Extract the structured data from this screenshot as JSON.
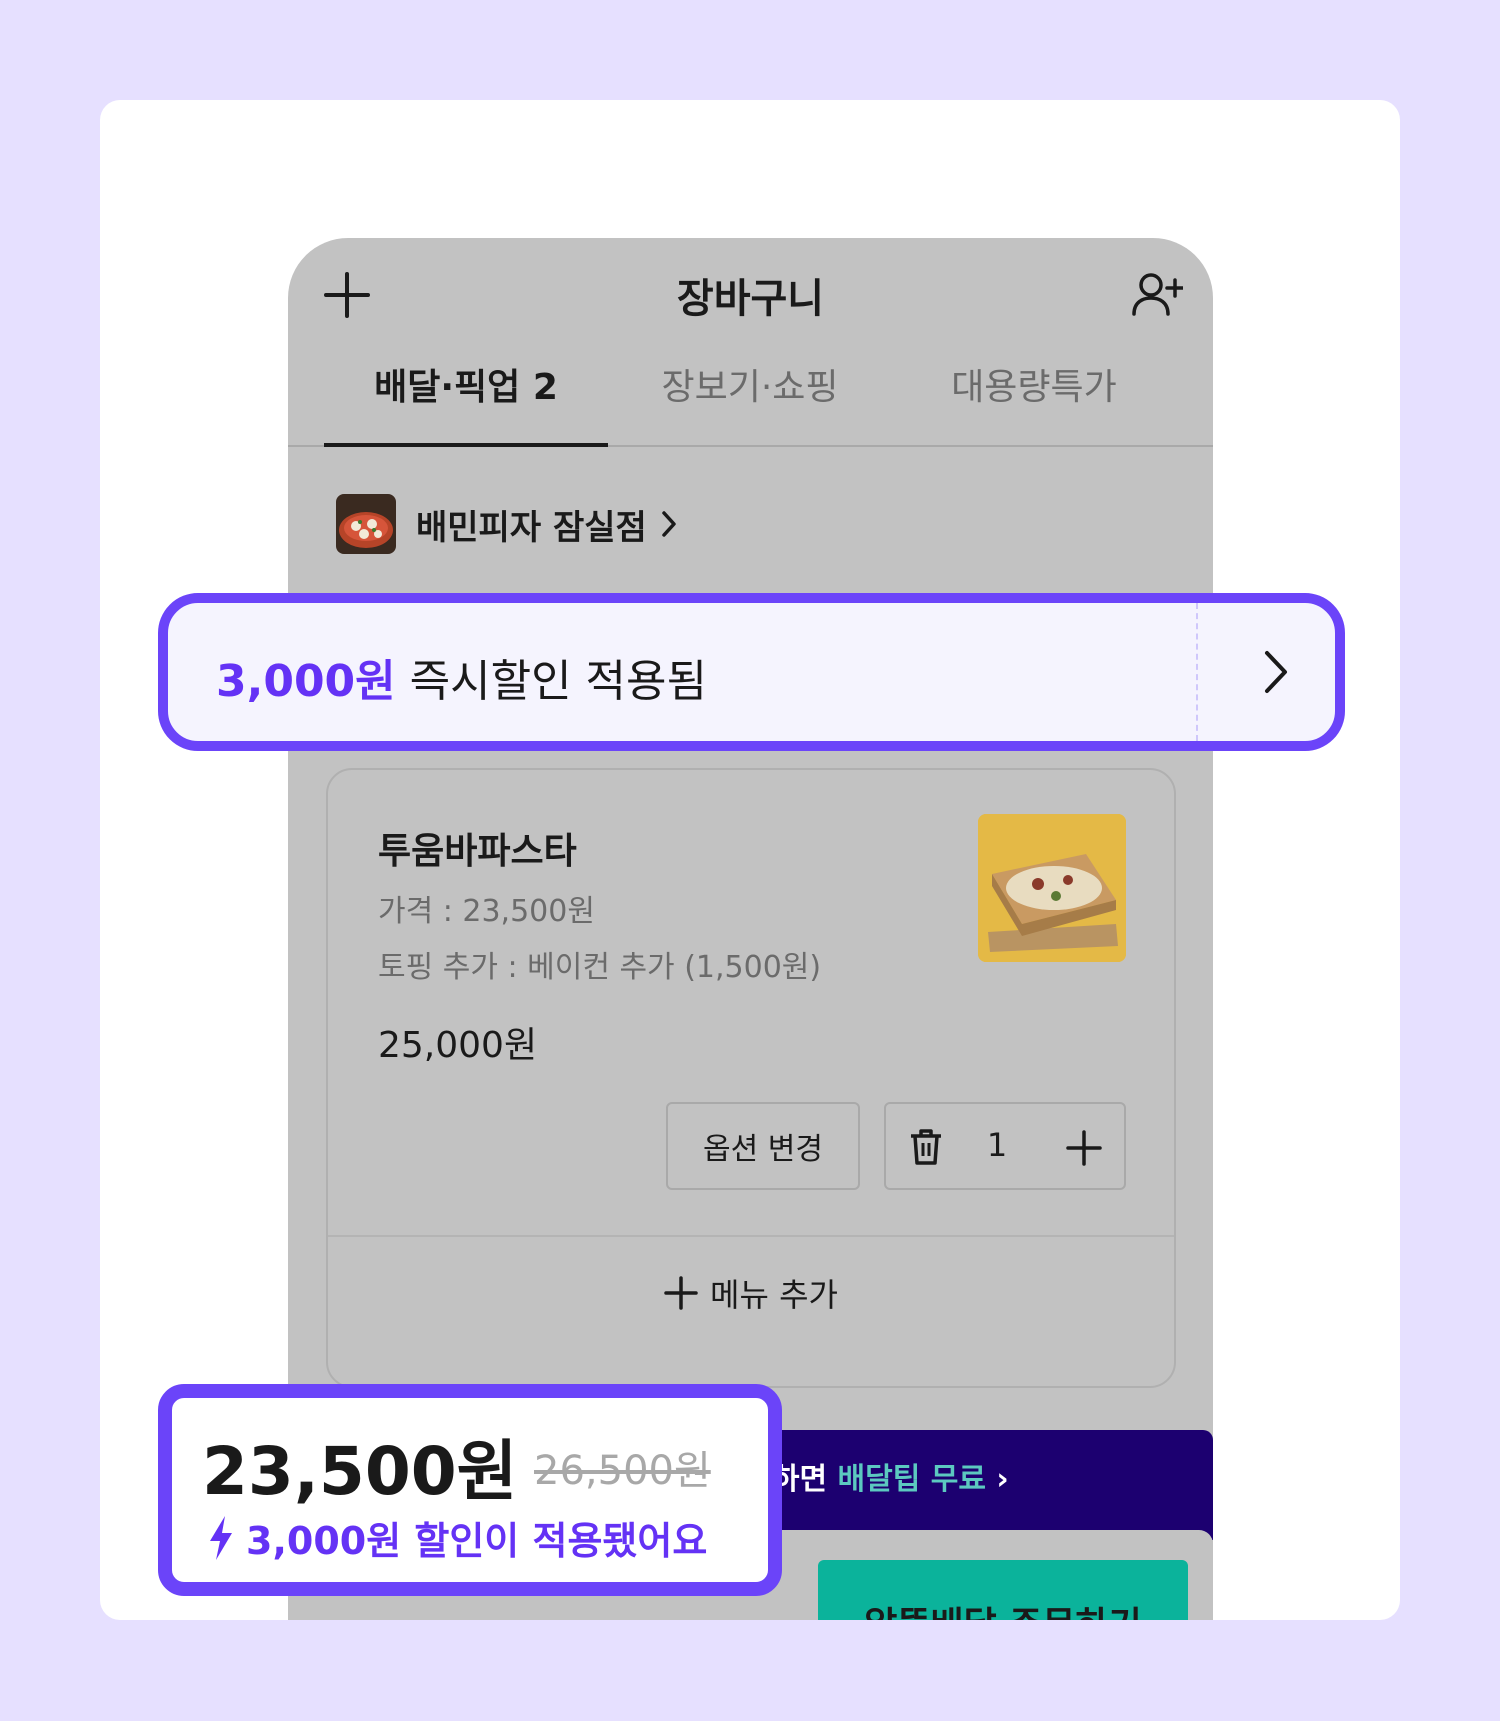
{
  "header": {
    "title": "장바구니"
  },
  "tabs": [
    {
      "label": "배달·픽업 2"
    },
    {
      "label": "장보기·쇼핑"
    },
    {
      "label": "대용량특가"
    }
  ],
  "store": {
    "name": "배민피자 잠실점"
  },
  "discount_banner": {
    "amount": "3,000원",
    "text": " 즉시할인 적용됨"
  },
  "item": {
    "name": "투움바파스타",
    "price": "가격 : 23,500원",
    "option": "토핑 추가 : 베이컨 추가 (1,500원)",
    "total": "25,000원",
    "change_option_label": "옵션 변경",
    "quantity": "1",
    "add_menu_label": "메뉴 추가"
  },
  "club_banner": {
    "text": "배민클럽 지금 가입하면 ",
    "highlight": "배달팁 무료",
    "chevron": " ›"
  },
  "summary": {
    "price_now": "23,500원",
    "price_old": "26,500원",
    "discount_note": "3,000원 할인이 적용됐어요"
  },
  "order_button": {
    "label": "알뜰배달 주문하기"
  },
  "colors": {
    "accent": "#6b44f9",
    "brand_purple": "#6432f5",
    "order_green": "#0bb39b",
    "club_navy": "#1c0070"
  },
  "icons": [
    "plus-icon",
    "add-user-icon",
    "chevron-right-icon",
    "trash-icon",
    "bolt-icon"
  ]
}
